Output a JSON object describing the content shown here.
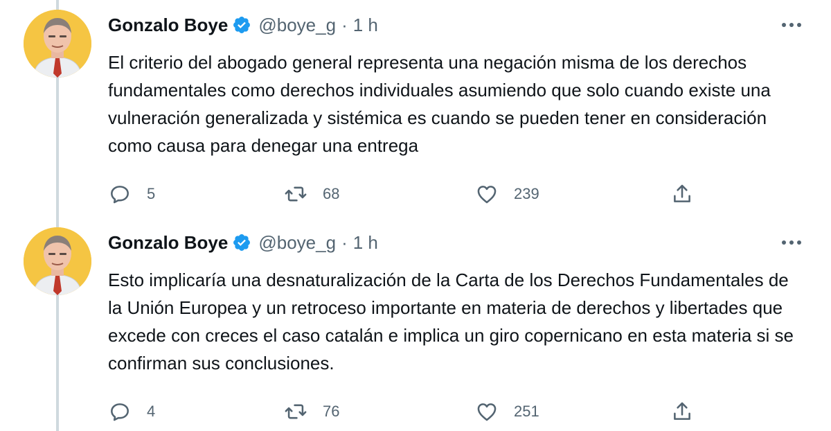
{
  "colors": {
    "text_primary": "#0f1419",
    "text_secondary": "#536471",
    "verified_blue": "#1d9bf0",
    "thread_line": "#cfd9de",
    "avatar_bg": "#f5c543"
  },
  "tweets": [
    {
      "author": {
        "name": "Gonzalo Boye",
        "handle": "@boye_g",
        "verified": true,
        "avatar_icon": "cartoon-portrait-avatar"
      },
      "separator": "·",
      "time": "1 h",
      "text": "El criterio del abogado general representa una negación misma de los derechos fundamentales como derechos individuales asumiendo que solo cuando existe una vulneración generalizada y sistémica es cuando se pueden tener en consideración como causa para denegar una entrega",
      "actions": {
        "replies": "5",
        "retweets": "68",
        "likes": "239"
      }
    },
    {
      "author": {
        "name": "Gonzalo Boye",
        "handle": "@boye_g",
        "verified": true,
        "avatar_icon": "cartoon-portrait-avatar"
      },
      "separator": "·",
      "time": "1 h",
      "text": "Esto implicaría una desnaturalización de la Carta de los Derechos Fundamentales de la Unión Europea y un retroceso importante en materia de derechos y libertades que excede con creces el caso catalán e implica un giro copernicano en esta materia si se confirman sus conclusiones.",
      "actions": {
        "replies": "4",
        "retweets": "76",
        "likes": "251"
      }
    }
  ]
}
